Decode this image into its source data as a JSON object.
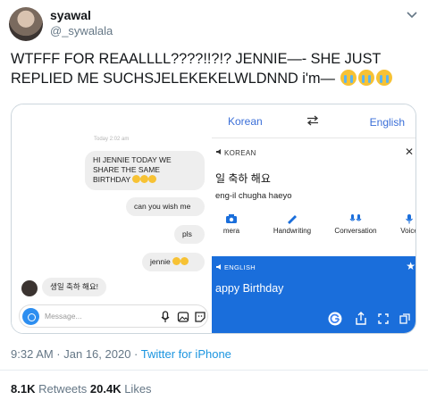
{
  "author": {
    "display_name": "syawal",
    "handle": "@_sywalala"
  },
  "tweet": {
    "line1": "WTFFF FOR REAALLLL????!!?!?  JENNIE—- SHE JUST",
    "line2": "REPLIED ME SUCHSJELEKEKELWLDNND i'm—",
    "emoji_name": "loudly-crying-face",
    "emoji_count": 3
  },
  "chat": {
    "timestamp": "Today 2:02 am",
    "messages": [
      {
        "text": "HI JENNIE TODAY WE SHARE THE SAME BIRTHDAY",
        "emoji": 3
      },
      {
        "text": "can you wish me"
      },
      {
        "text": "pls"
      },
      {
        "text": "jennie",
        "emoji": 2
      }
    ],
    "reply": "생일 축하 해요!",
    "input_placeholder": "Message..."
  },
  "translate": {
    "source_lang": "Korean",
    "target_lang": "English",
    "swap_icon": "swap-arrows-icon",
    "source_label": "KOREAN",
    "source_text": "일 축하 해요",
    "romanization": "eng-il chugha haeyo",
    "tools": [
      "mera",
      "Handwriting",
      "Conversation",
      "Voice"
    ],
    "result_label": "ENGLISH",
    "result_text": "appy Birthday",
    "accent_color": "#1a6edb"
  },
  "footer": {
    "time": "9:32 AM · Jan 16, 2020 · ",
    "source": "Twitter for iPhone",
    "retweets_count": "8.1K",
    "retweets_label": " Retweets  ",
    "likes_count": "20.4K",
    "likes_label": " Likes"
  }
}
